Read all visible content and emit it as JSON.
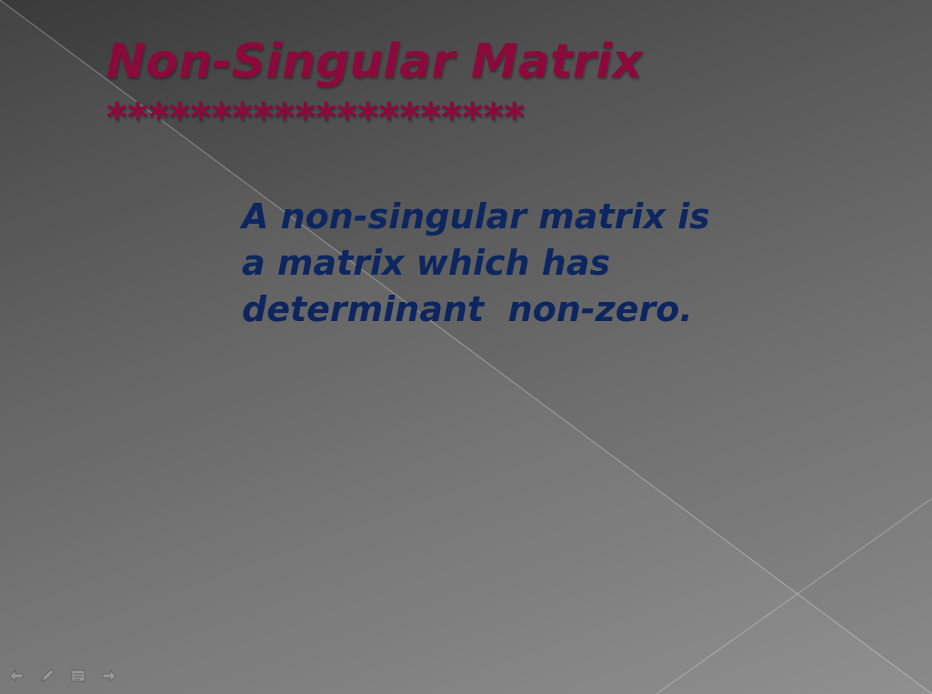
{
  "slide": {
    "title": "Non-Singular Matrix",
    "separator": "********************",
    "body_lines": [
      "A non-singular matrix is",
      "a matrix which has",
      "determinant  non-zero."
    ]
  },
  "colors": {
    "title": "#8b0a3c",
    "body": "#0d2660",
    "background_dark": "#3a3a3a",
    "background_light": "#8a8a8a"
  },
  "nav": {
    "icons": [
      "previous-slide-icon",
      "pen-icon",
      "slide-menu-icon",
      "next-slide-icon"
    ]
  }
}
